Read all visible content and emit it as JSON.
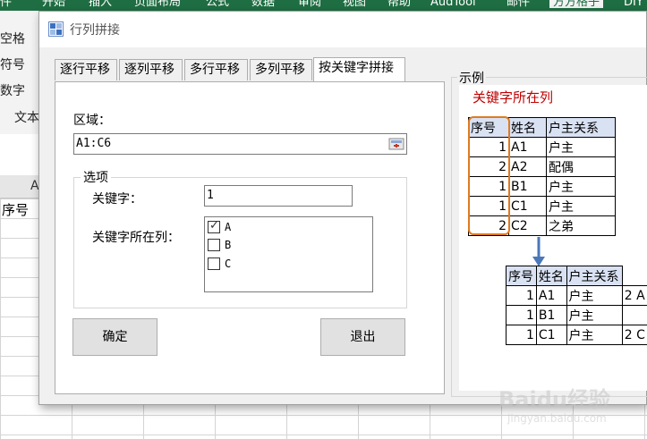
{
  "excel": {
    "ribbon_tabs": [
      "件",
      "开始",
      "插入",
      "页面布局",
      "公式",
      "数据",
      "审阅",
      "视图",
      "帮助",
      "AudTool",
      "邮件",
      "方方格子",
      "DIY"
    ],
    "left_labels": [
      "空格",
      "符号",
      "数字",
      "文本"
    ],
    "column_header": "A",
    "cell_a1": "序号"
  },
  "dialog": {
    "title": "行列拼接",
    "tabs": [
      "逐行平移",
      "逐列平移",
      "多行平移",
      "多列平移",
      "按关键字拼接"
    ],
    "active_tab": "按关键字拼接",
    "range_label": "区域：",
    "range_value": "A1:C6",
    "options_legend": "选项",
    "keyword_label": "关键字：",
    "keyword_value": "1",
    "keyword_col_label": "关键字所在列：",
    "columns": [
      {
        "label": "A",
        "checked": true
      },
      {
        "label": "B",
        "checked": false
      },
      {
        "label": "C",
        "checked": false
      }
    ],
    "ok_label": "确定",
    "exit_label": "退出"
  },
  "example": {
    "title": "示例",
    "caption": "关键字所在列",
    "headers": [
      "序号",
      "姓名",
      "户主关系"
    ],
    "before_rows": [
      [
        "1",
        "A1",
        "户主"
      ],
      [
        "2",
        "A2",
        "配偶"
      ],
      [
        "1",
        "B1",
        "户主"
      ],
      [
        "1",
        "C1",
        "户主"
      ],
      [
        "2",
        "C2",
        "之弟"
      ]
    ],
    "after_rows": [
      [
        "1",
        "A1",
        "户主",
        "2",
        "A"
      ],
      [
        "1",
        "B1",
        "户主",
        "",
        ""
      ],
      [
        "1",
        "C1",
        "户主",
        "2",
        "C"
      ]
    ],
    "highlight_color": "#e07a1f",
    "arrow_color": "#4a78b8"
  },
  "watermark": {
    "big": "Baidu经验",
    "small": "jingyan.baidu.com"
  }
}
